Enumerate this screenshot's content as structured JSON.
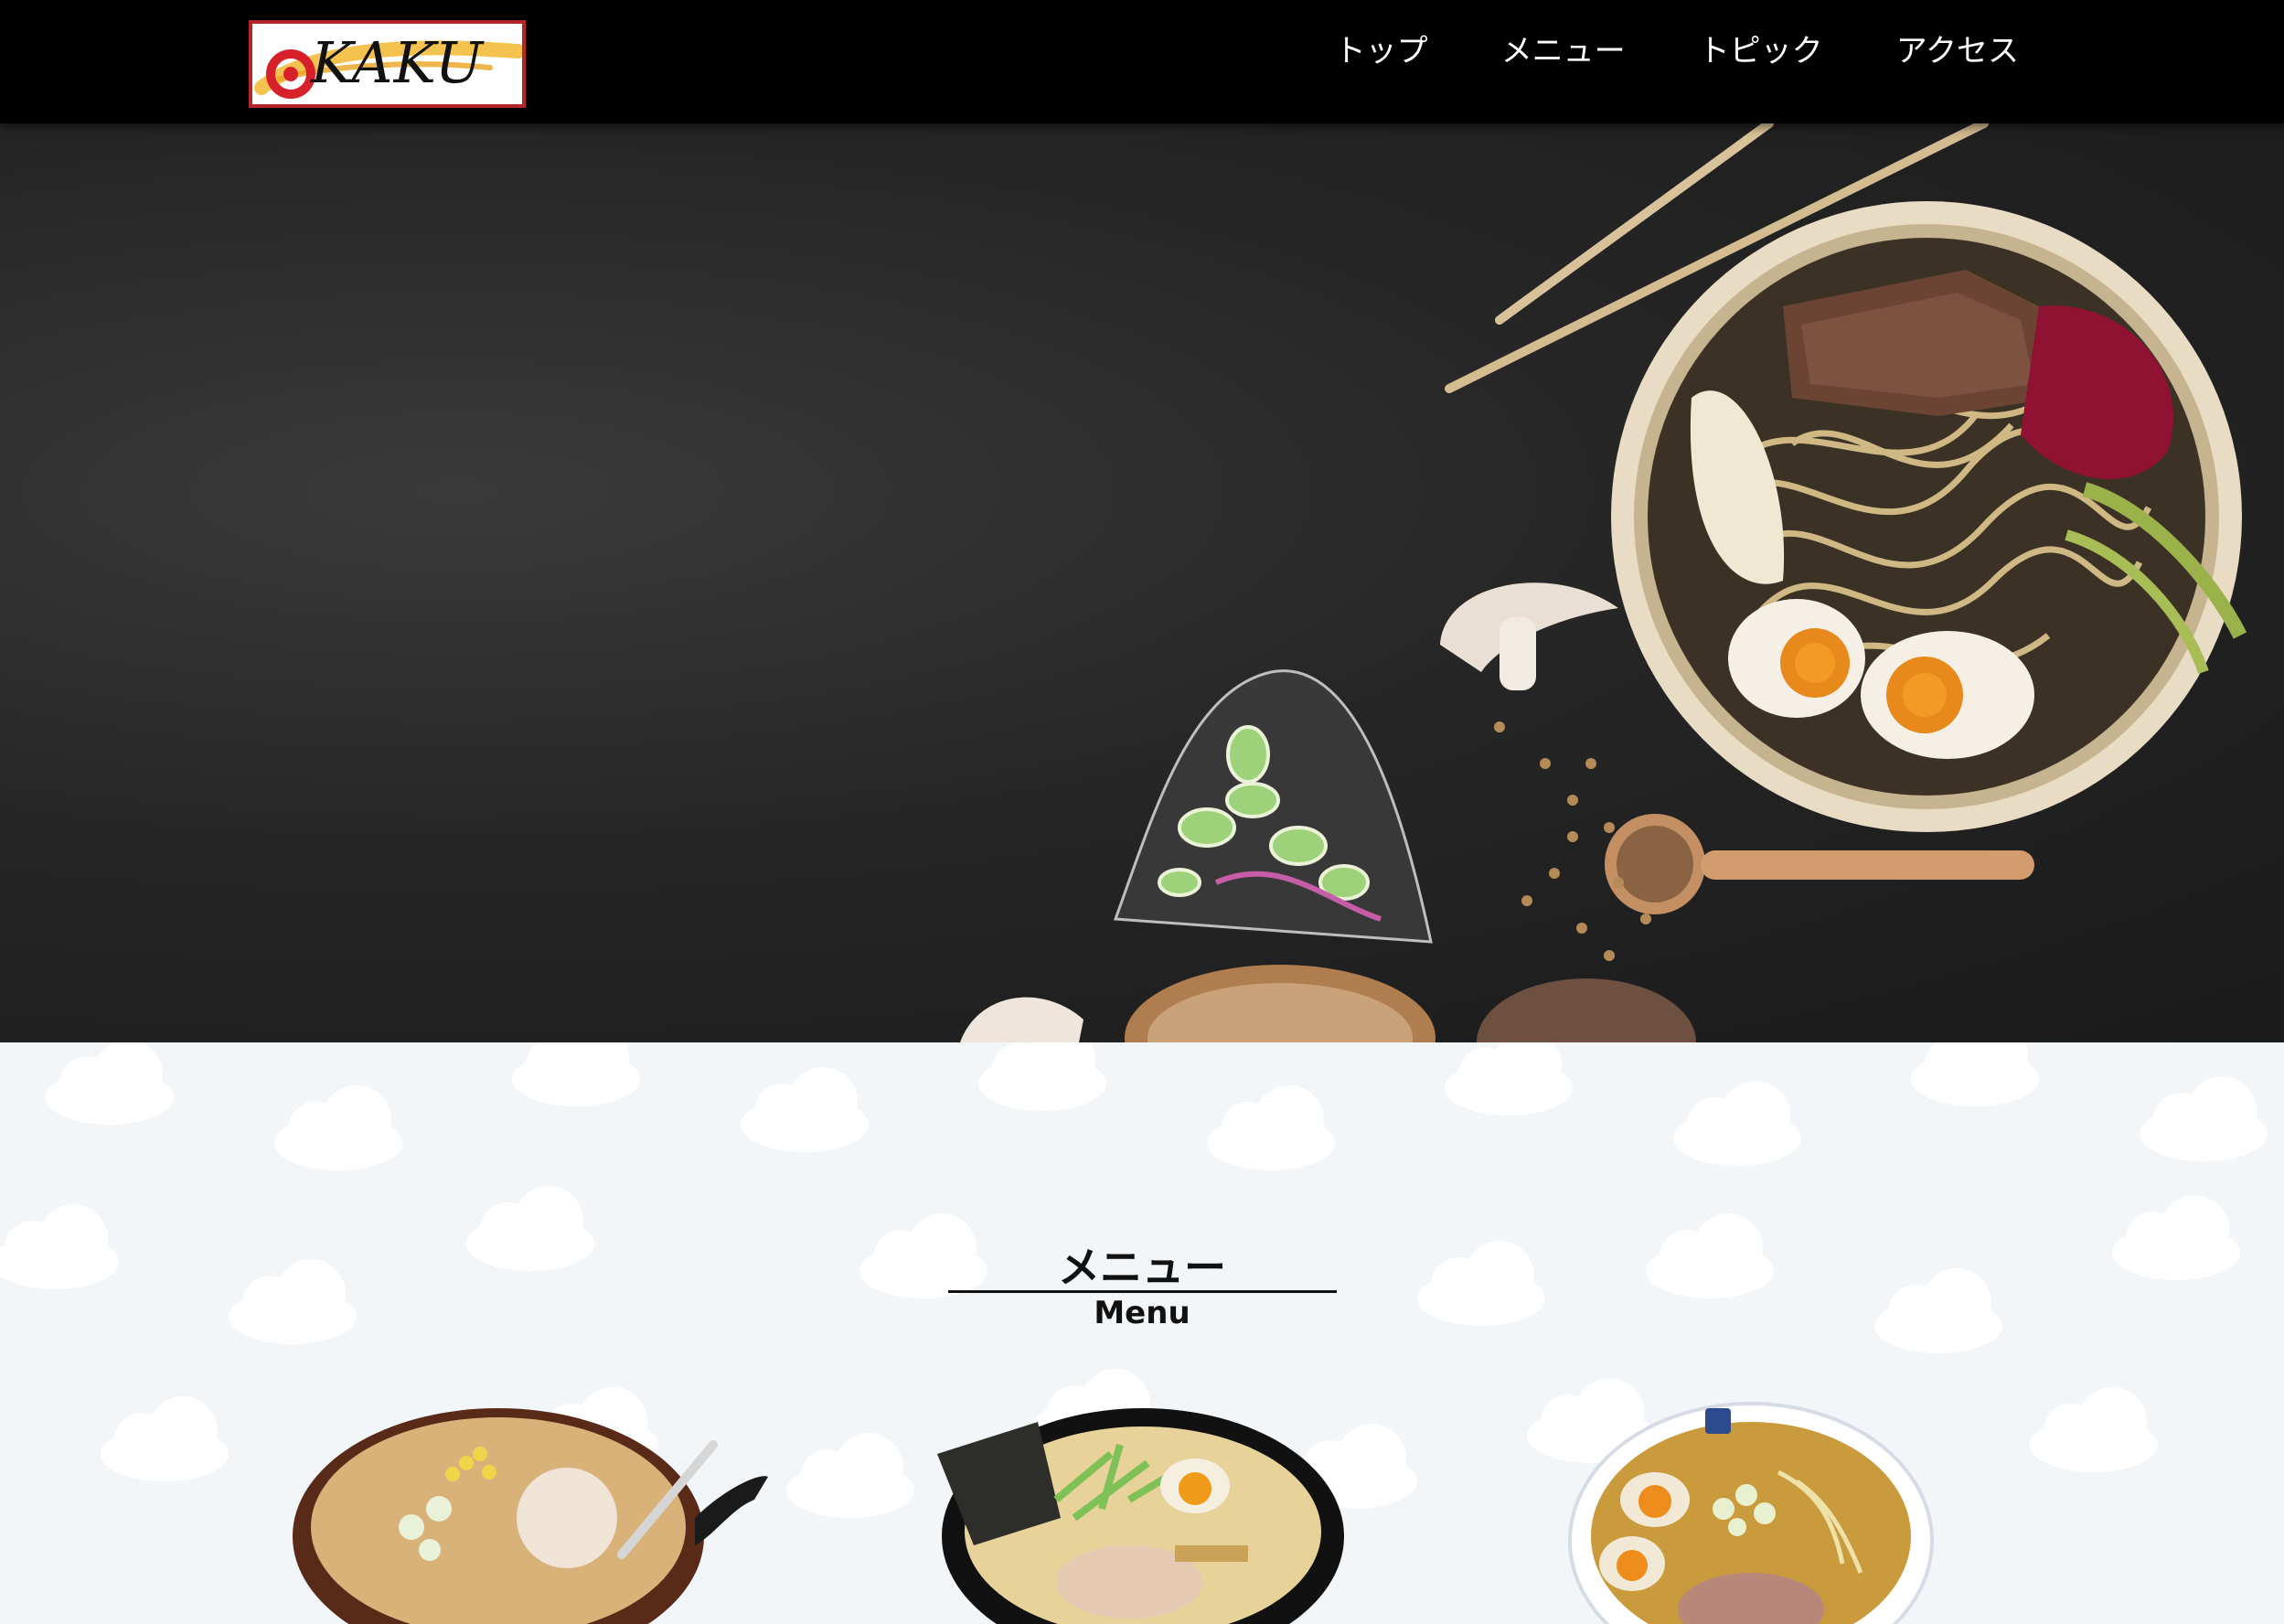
{
  "header": {
    "logo_text": "KAKU",
    "nav": [
      {
        "label": "トップ"
      },
      {
        "label": "メニュー"
      },
      {
        "label": "トピック"
      },
      {
        "label": "アクセス"
      }
    ]
  },
  "menu_section": {
    "title": "メニュー",
    "subtitle": "Menu",
    "dishes": [
      {
        "icon": "miso-ramen-bowl-image"
      },
      {
        "icon": "shio-ramen-bowl-image"
      },
      {
        "icon": "shoyu-ramen-bowl-image"
      }
    ]
  },
  "colors": {
    "header_bg": "#000000",
    "hero_bg": "#262626",
    "section_bg": "#f2f6f8",
    "logo_border": "#b3252a"
  }
}
